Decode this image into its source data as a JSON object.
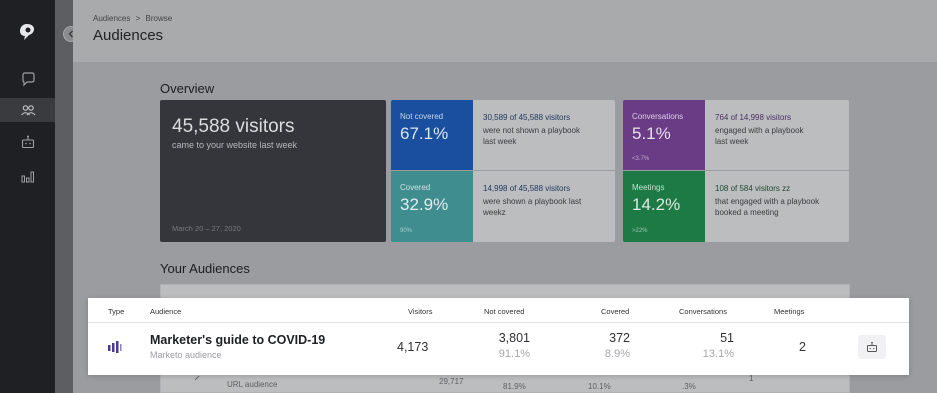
{
  "breadcrumb": {
    "parent": "Audiences",
    "separator": ">",
    "current": "Browse"
  },
  "page": {
    "title": "Audiences"
  },
  "overview": {
    "section_title": "Overview",
    "visitors": {
      "headline": "45,588 visitors",
      "subtitle": "came to your website last week",
      "date_range": "March 20 – 27, 2020"
    },
    "not_covered": {
      "label": "Not covered",
      "pct": "67.1%",
      "line1": "30,589 of 45,588 visitors",
      "line2": "were not shown a playbook",
      "line3": "last week"
    },
    "covered": {
      "label": "Covered",
      "pct": "32.9%",
      "delta": "90%",
      "line1": "14,998 of 45,588 visitors",
      "line2": "were shown a playbook last",
      "line3": "weekz"
    },
    "conversations": {
      "label": "Conversations",
      "pct": "5.1%",
      "delta": "<3.7%",
      "line1": "764 of 14,998 visitors",
      "line2": "engaged with a playbook",
      "line3": "last week"
    },
    "meetings": {
      "label": "Meetings",
      "pct": "14.2%",
      "delta": ">22%",
      "line1": "108 of 584 visitors zz",
      "line2": "that engaged with a playbook",
      "line3": "booked a meeting"
    }
  },
  "audiences": {
    "section_title": "Your Audiences",
    "columns": {
      "type": "Type",
      "audience": "Audience",
      "visitors": "Visitors",
      "not_covered": "Not covered",
      "covered": "Covered",
      "conversations": "Conversations",
      "meetings": "Meetings"
    },
    "highlighted_row": {
      "name": "Marketer's guide to COVID-19",
      "type": "Marketo audience",
      "visitors": "4,173",
      "not_covered": "3,801",
      "not_covered_pct": "91.1%",
      "covered": "372",
      "covered_pct": "8.9%",
      "conversations": "51",
      "conversations_pct": "13.1%",
      "meetings": "2"
    },
    "background_row": {
      "type": "URL audience",
      "visitors": "29,717",
      "not_covered_pct": "81.9%",
      "covered_pct": "10.1%",
      "conversations_pct": ".3%",
      "meetings": "1"
    }
  },
  "colors": {
    "blue": "#1a4fa0",
    "teal": "#3f8d8f",
    "purple": "#6b3c86",
    "green": "#1d7a44",
    "row_icon": "#4a3b8f"
  },
  "icons": [
    "logo-icon",
    "chat-icon",
    "people-icon",
    "bot-icon",
    "bar-chart-icon",
    "chevron-left-icon",
    "audience-bars-icon"
  ]
}
